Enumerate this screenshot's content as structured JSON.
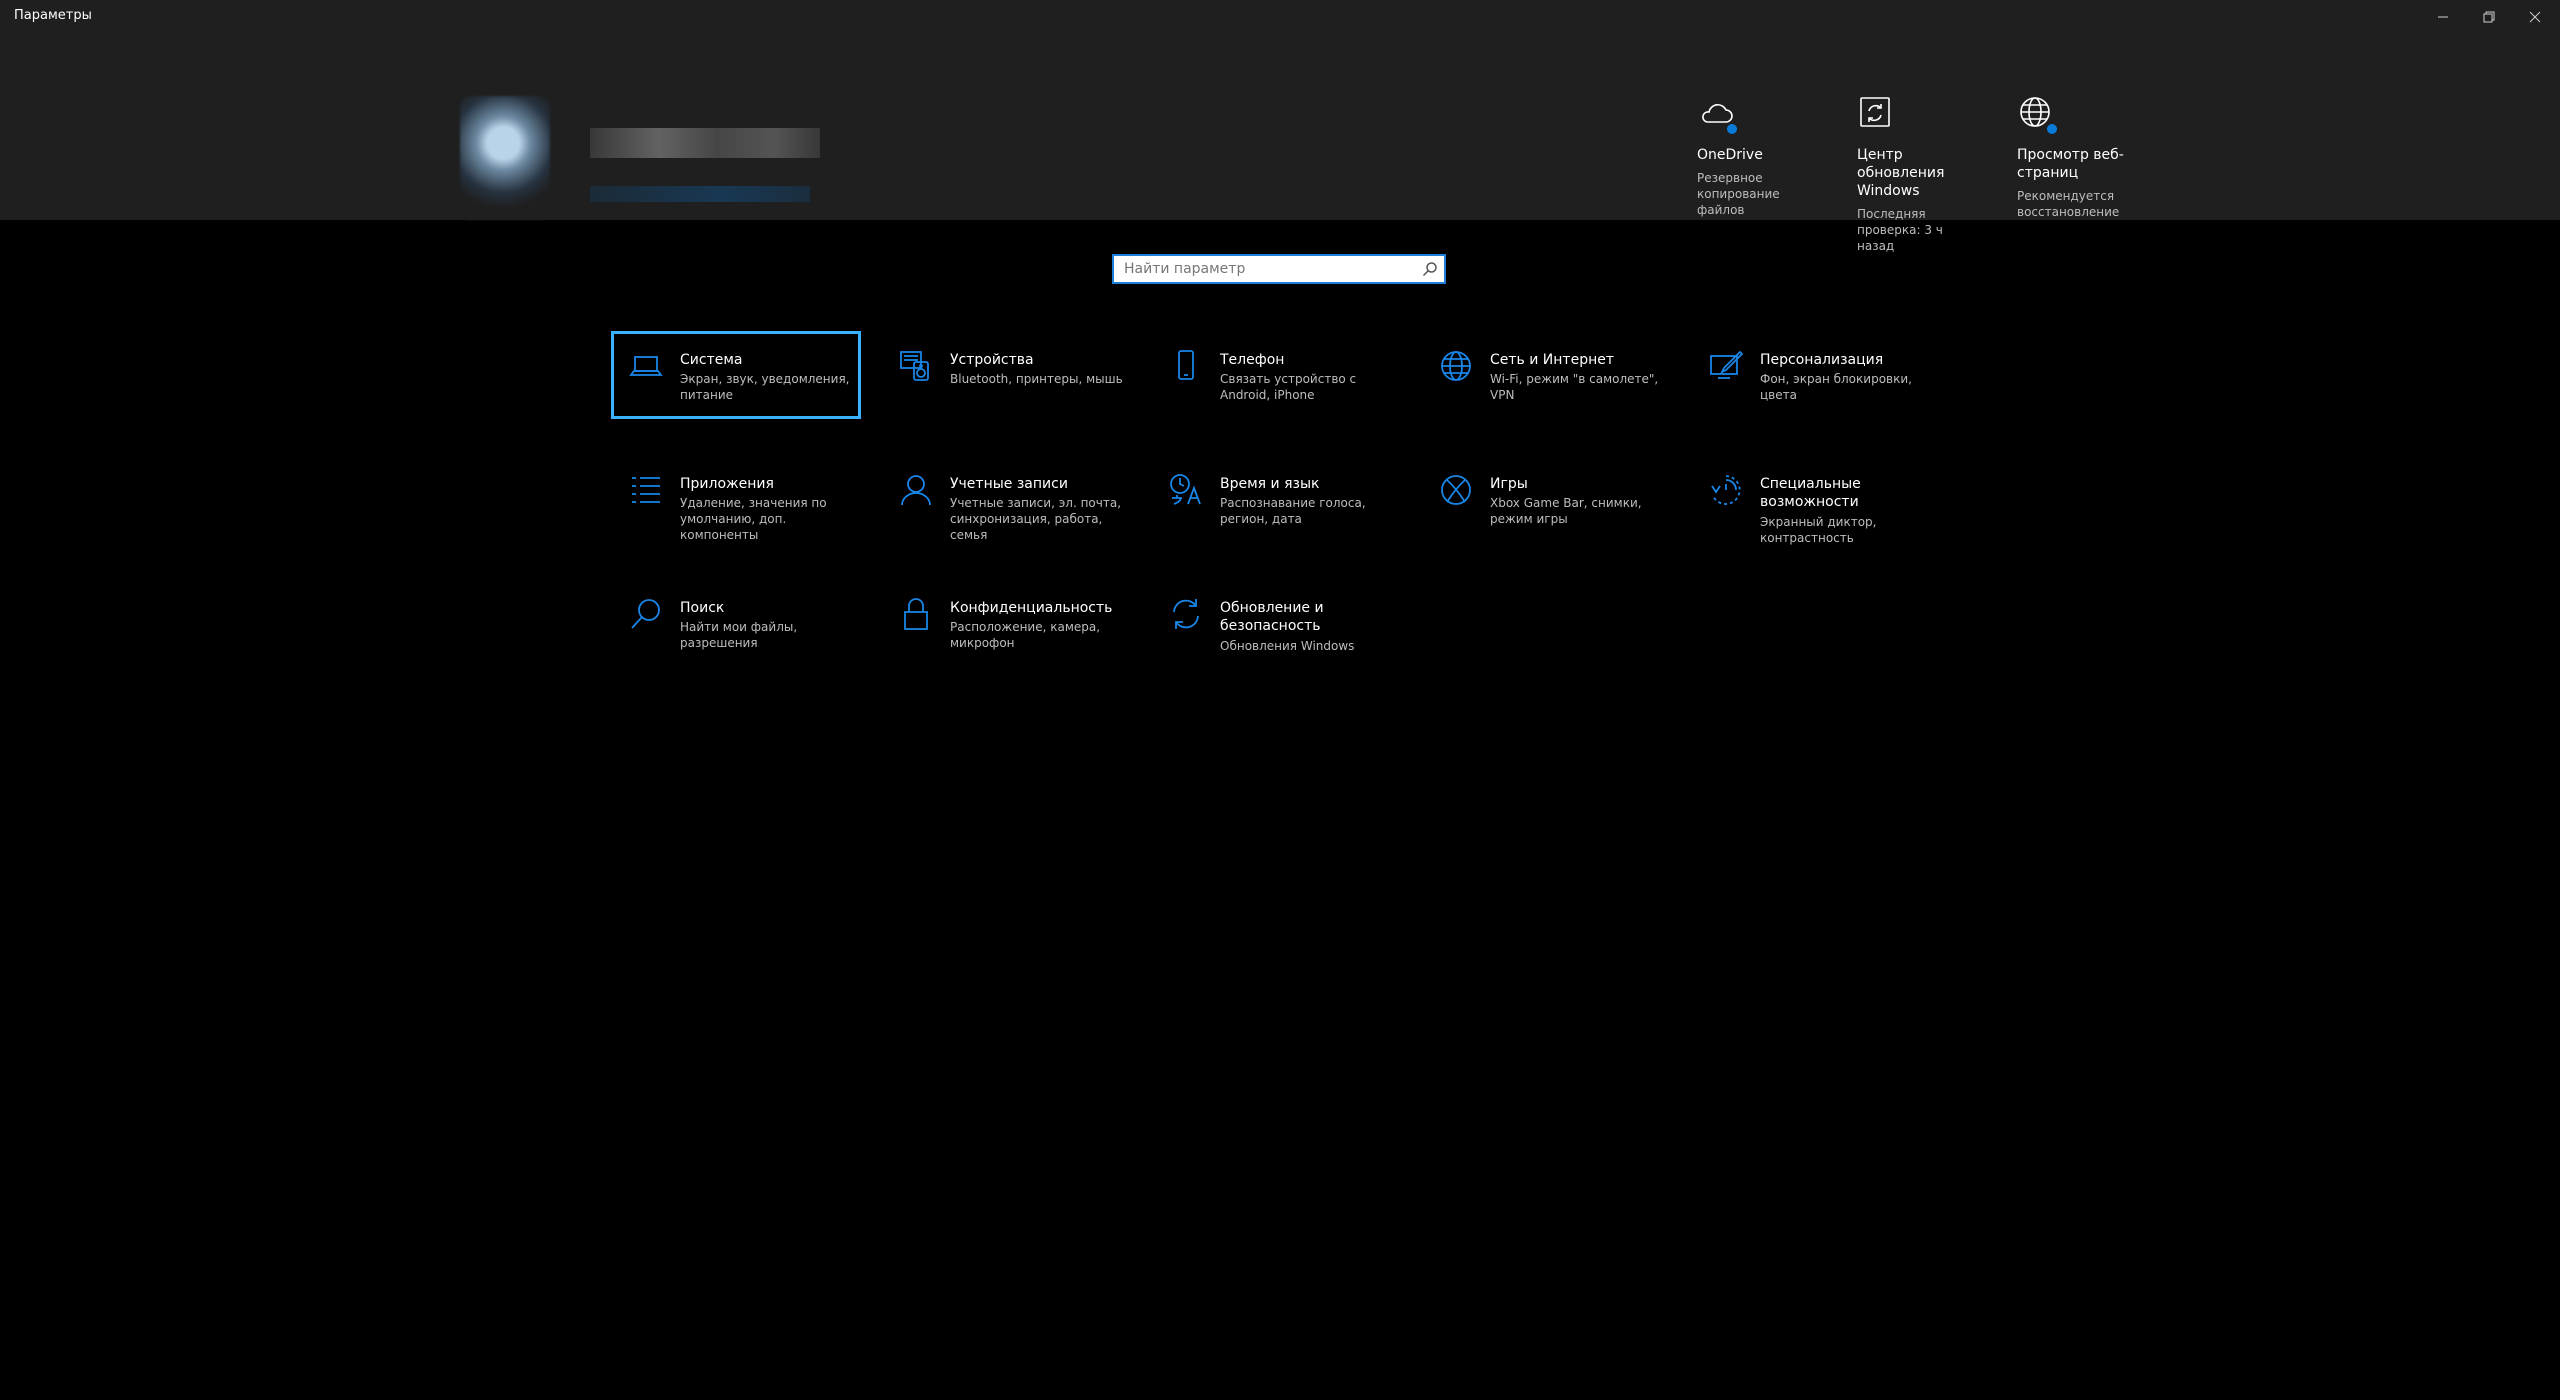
{
  "window": {
    "title": "Параметры"
  },
  "quick_links": [
    {
      "title": "OneDrive",
      "subtitle": "Резервное копирование файлов",
      "icon": "onedrive-cloud-icon"
    },
    {
      "title": "Центр обновления Windows",
      "subtitle": "Последняя проверка: 3 ч назад",
      "icon": "windows-update-icon"
    },
    {
      "title": "Просмотр веб-страниц",
      "subtitle": "Рекомендуется восстановление",
      "icon": "globe-icon"
    }
  ],
  "search": {
    "placeholder": "Найти параметр"
  },
  "tiles": [
    {
      "title": "Система",
      "subtitle": "Экран, звук, уведомления, питание",
      "icon": "laptop-icon"
    },
    {
      "title": "Устройства",
      "subtitle": "Bluetooth, принтеры, мышь",
      "icon": "devices-icon"
    },
    {
      "title": "Телефон",
      "subtitle": "Связать устройство с Android, iPhone",
      "icon": "phone-icon"
    },
    {
      "title": "Сеть и Интернет",
      "subtitle": "Wi-Fi, режим \"в самолете\", VPN",
      "icon": "globe-icon"
    },
    {
      "title": "Персонализация",
      "subtitle": "Фон, экран блокировки, цвета",
      "icon": "personalization-icon"
    },
    {
      "title": "Приложения",
      "subtitle": "Удаление, значения по умолчанию, доп. компоненты",
      "icon": "apps-list-icon"
    },
    {
      "title": "Учетные записи",
      "subtitle": "Учетные записи, эл. почта, синхронизация, работа, семья",
      "icon": "user-icon"
    },
    {
      "title": "Время и язык",
      "subtitle": "Распознавание голоса, регион, дата",
      "icon": "time-language-icon"
    },
    {
      "title": "Игры",
      "subtitle": "Xbox Game Bar, снимки, режим игры",
      "icon": "xbox-icon"
    },
    {
      "title": "Специальные возможности",
      "subtitle": "Экранный диктор, контрастность",
      "icon": "accessibility-icon"
    },
    {
      "title": "Поиск",
      "subtitle": "Найти мои файлы, разрешения",
      "icon": "search-icon"
    },
    {
      "title": "Конфиденциальность",
      "subtitle": "Расположение, камера, микрофон",
      "icon": "lock-icon"
    },
    {
      "title": "Обновление и безопасность",
      "subtitle": "Обновления Windows",
      "icon": "update-sync-icon"
    }
  ],
  "colors": {
    "accent": "#1a86e8",
    "focus": "#3ab1ff",
    "header_bg": "#1f1f1f",
    "page_bg": "#000000"
  }
}
